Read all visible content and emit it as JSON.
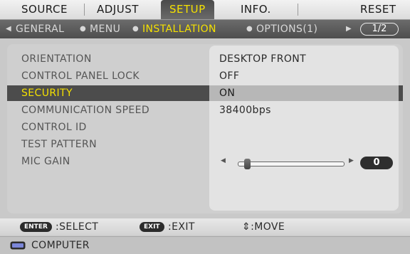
{
  "tabs": [
    {
      "label": "SOURCE"
    },
    {
      "label": "ADJUST"
    },
    {
      "label": "SETUP",
      "active": true
    },
    {
      "label": "INFO."
    },
    {
      "label": "RESET"
    }
  ],
  "subtabs": [
    {
      "label": "GENERAL"
    },
    {
      "label": "MENU"
    },
    {
      "label": "INSTALLATION",
      "active": true
    },
    {
      "label": "OPTIONS(1)"
    }
  ],
  "page_indicator": "1/2",
  "menu": [
    {
      "label": "ORIENTATION",
      "value": "DESKTOP FRONT"
    },
    {
      "label": "CONTROL PANEL LOCK",
      "value": "OFF"
    },
    {
      "label": "SECURITY",
      "value": "ON",
      "selected": true
    },
    {
      "label": "COMMUNICATION SPEED",
      "value": "38400bps"
    },
    {
      "label": "CONTROL ID",
      "value": ""
    },
    {
      "label": "TEST PATTERN",
      "value": ""
    },
    {
      "label": "MIC GAIN",
      "value": ""
    }
  ],
  "mic_gain": {
    "value": "0",
    "level": 0
  },
  "guide": {
    "enter_key": "ENTER",
    "enter_text": ":SELECT",
    "exit_key": "EXIT",
    "exit_text": ":EXIT",
    "move_text": "⇕:MOVE"
  },
  "source": {
    "label": "COMPUTER",
    "icon": "computer-monitor-icon"
  },
  "colors": {
    "active_text": "#f4e000",
    "selected_row_bg": "#4c4c4c"
  }
}
